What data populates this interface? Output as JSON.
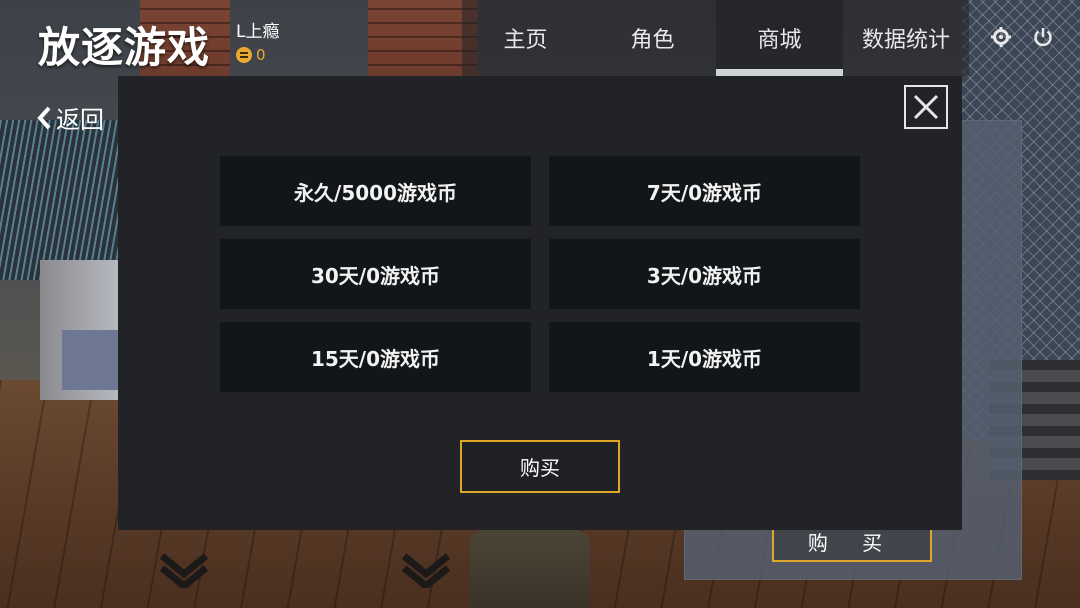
{
  "app": {
    "title": "放逐游戏"
  },
  "user": {
    "name": "L上瘾",
    "coins": "0"
  },
  "nav": {
    "tabs": [
      {
        "label": "主页"
      },
      {
        "label": "角色"
      },
      {
        "label": "商城"
      },
      {
        "label": "数据统计"
      }
    ],
    "active_tab": "商城"
  },
  "header_icons": [
    "settings-icon",
    "power-icon"
  ],
  "back": {
    "label": "返回"
  },
  "modal": {
    "options": [
      {
        "label": "永久/5000游戏币"
      },
      {
        "label": "7天/0游戏币"
      },
      {
        "label": "30天/0游戏币"
      },
      {
        "label": "3天/0游戏币"
      },
      {
        "label": "15天/0游戏币"
      },
      {
        "label": "1天/0游戏币"
      }
    ],
    "buy_label": "购买",
    "close_icon": "close-icon"
  },
  "background": {
    "buy_label": "购 买"
  },
  "colors": {
    "accent": "#e0a62a",
    "modal_bg": "#222326",
    "option_bg": "#121619"
  }
}
